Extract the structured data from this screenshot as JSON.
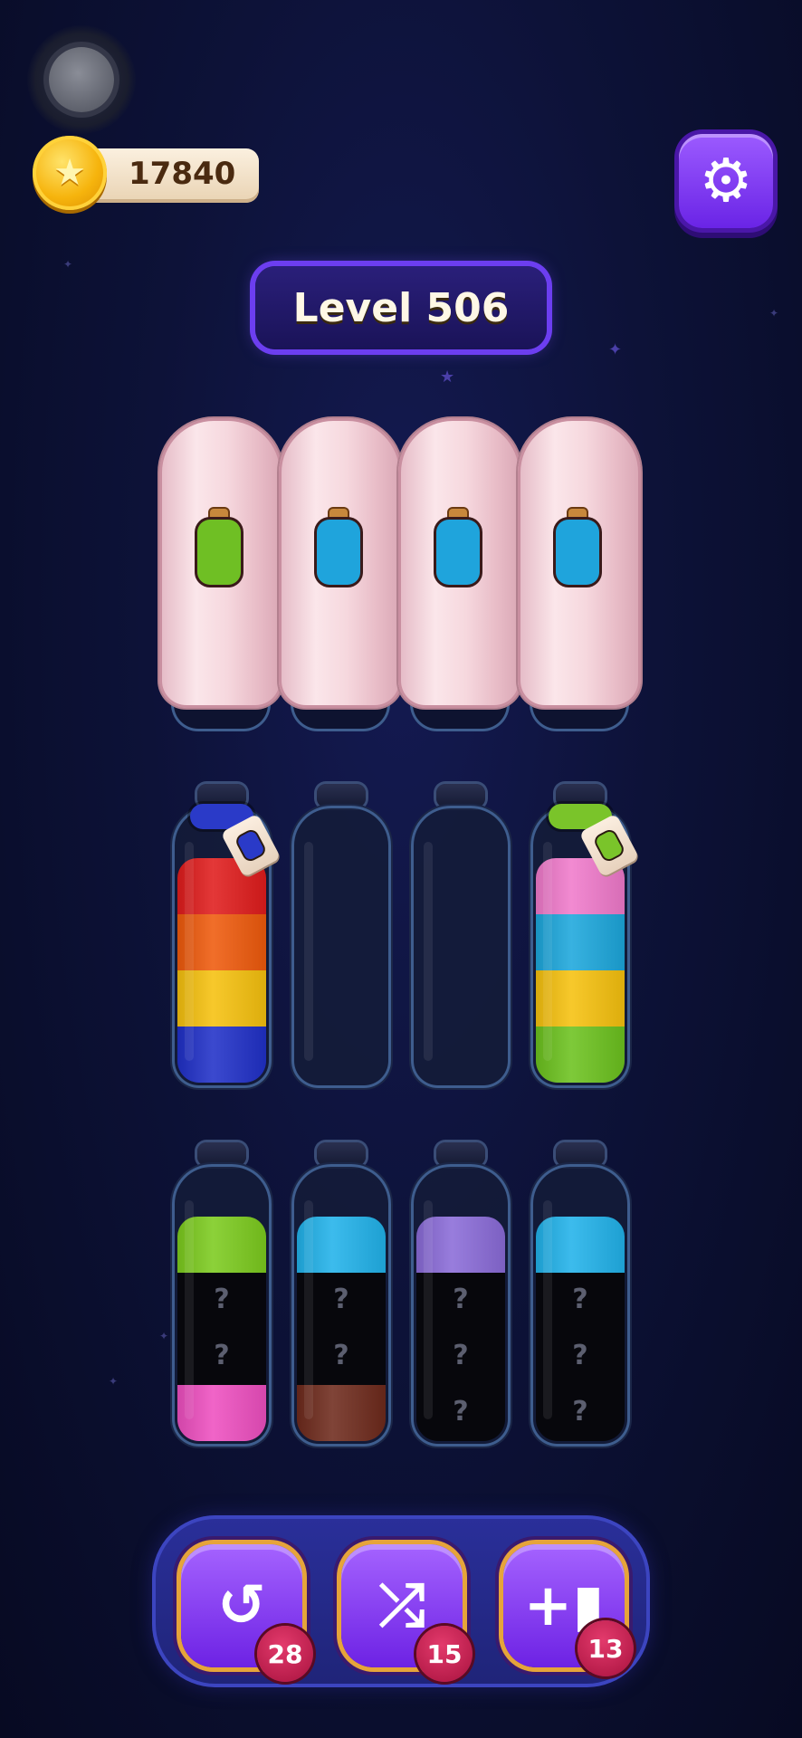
{
  "hud": {
    "coins": "17840",
    "settings_icon": "gear-icon",
    "coin_icon": "star-coin-icon"
  },
  "level": {
    "label": "Level 506"
  },
  "covered_bottles": [
    {
      "hint_color": "#6fbf24"
    },
    {
      "hint_color": "#1fa4dc"
    },
    {
      "hint_color": "#1fa4dc"
    },
    {
      "hint_color": "#1fa4dc"
    }
  ],
  "row2_bottles": [
    {
      "layers": [
        "#e01c1c",
        "#ef5a0c",
        "#f6c10e",
        "#2030c8"
      ],
      "tag": true,
      "rope_color": "#2a3ac8",
      "tag_color": "#2a3ac8"
    },
    {
      "layers": [],
      "tag": false
    },
    {
      "layers": [],
      "tag": false
    },
    {
      "layers": [
        "#f07acb",
        "#1ca7dc",
        "#f6c10e",
        "#6cc21e"
      ],
      "tag": true,
      "rope_color": "#7ac42a",
      "tag_color": "#7ac42a"
    }
  ],
  "row3_bottles": [
    {
      "layers": [
        "#7ccb1e",
        "hidden",
        "hidden",
        "#ee4fc0"
      ]
    },
    {
      "layers": [
        "#21b2ea",
        "hidden",
        "hidden",
        "#6e2a1c"
      ]
    },
    {
      "layers": [
        "#8a6bd8",
        "hidden",
        "hidden",
        "hidden"
      ]
    },
    {
      "layers": [
        "#21b2ea",
        "hidden",
        "hidden",
        "hidden"
      ]
    }
  ],
  "hidden_mark": "?",
  "powerups": [
    {
      "name": "undo",
      "icon": "undo-icon",
      "count": "28"
    },
    {
      "name": "shuffle",
      "icon": "shuffle-icon",
      "count": "15"
    },
    {
      "name": "add-bottle",
      "icon": "add-bottle-icon",
      "count": "13"
    }
  ]
}
